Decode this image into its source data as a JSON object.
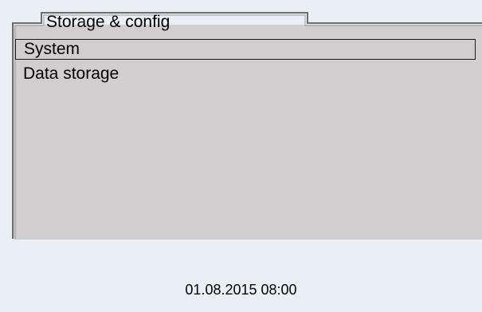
{
  "tab": {
    "title": "Storage & config"
  },
  "menu": {
    "items": [
      {
        "label": "System",
        "selected": true
      },
      {
        "label": "Data storage",
        "selected": false
      }
    ]
  },
  "status": {
    "datetime": "01.08.2015 08:00"
  },
  "colors": {
    "panel": "#d0cece",
    "background": "#e9eff4",
    "frame": "#707070"
  }
}
